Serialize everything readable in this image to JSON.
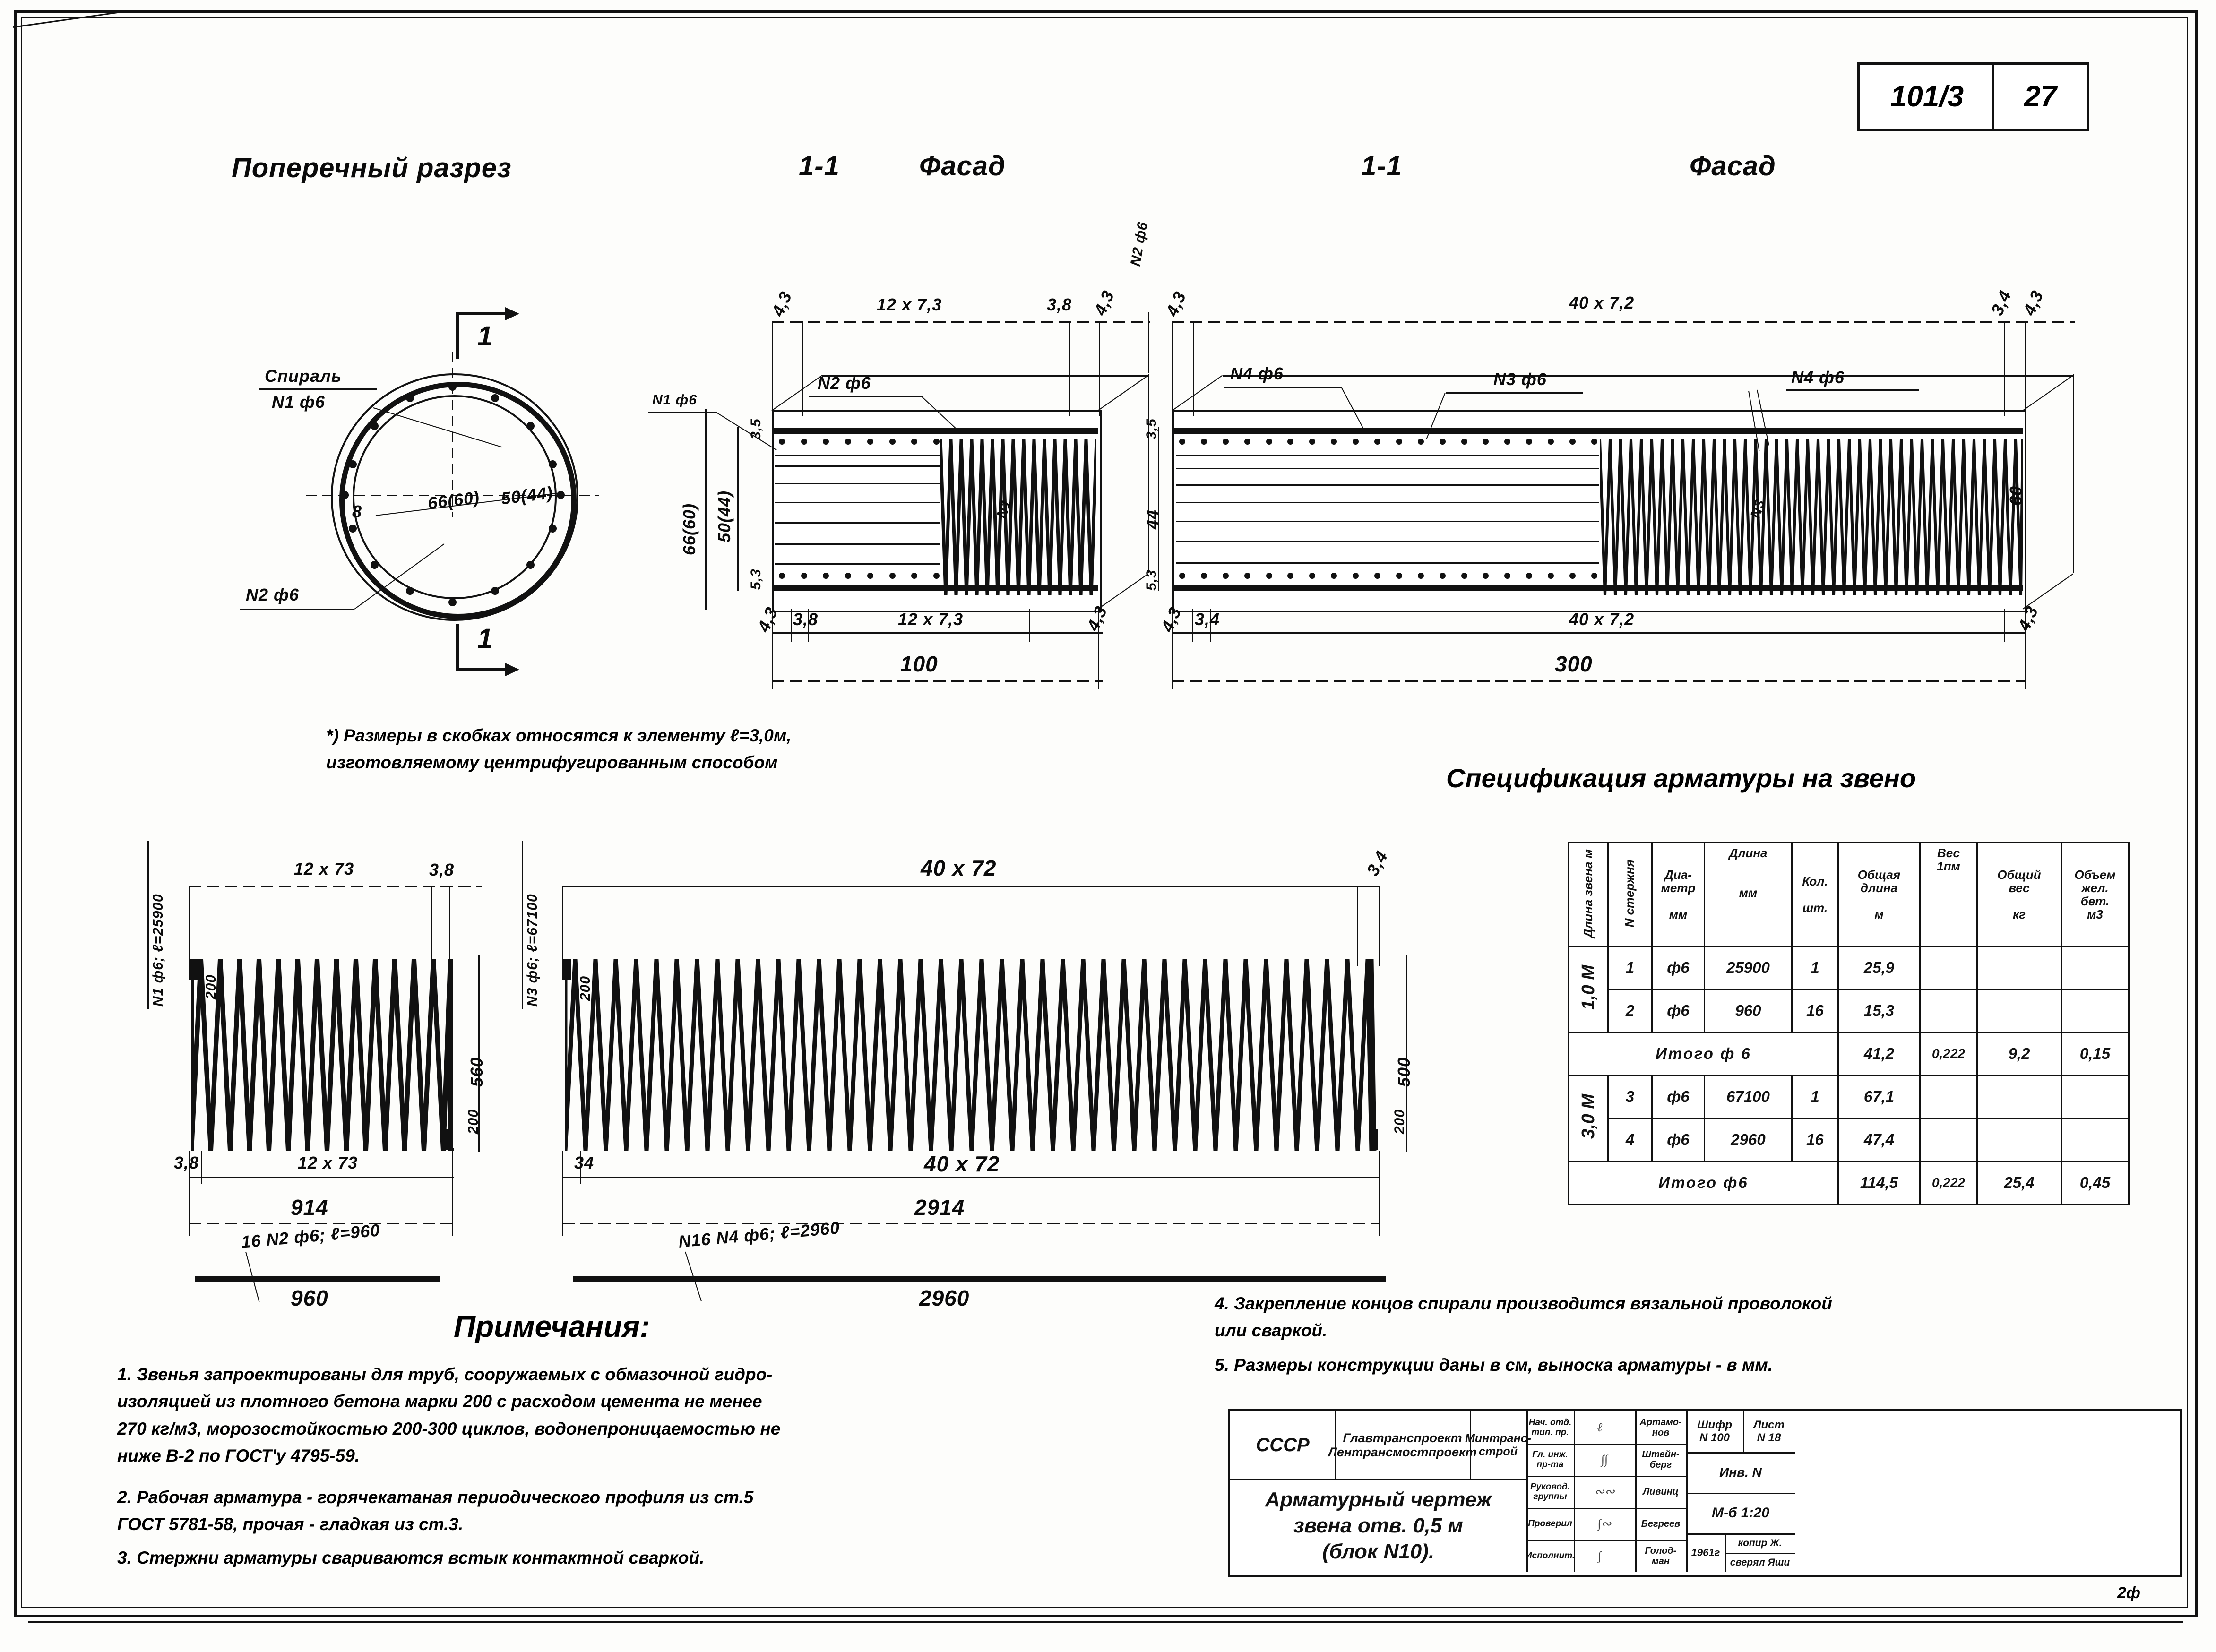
{
  "sheet": {
    "code_left": "101/3",
    "code_right": "27",
    "page_number": "2ф"
  },
  "headings": {
    "cross_section": "Поперечный разрез",
    "section_mark_1": "1-1",
    "facade_1": "Фасад",
    "section_mark_2": "1-1",
    "facade_2": "Фасад"
  },
  "section_view": {
    "spiral_label": "Спираль",
    "spiral_bar": "N1 ф6",
    "bar_n2": "N2 ф6",
    "diameter_outer": "66(60)",
    "diameter_inner": "50(44)",
    "cover": "8",
    "cut_mark": "1"
  },
  "elevation_1m": {
    "top_dims": [
      "4,3",
      "12 x 7,3",
      "3,8",
      "4,3"
    ],
    "top_right_label": "N2 ф6",
    "bottom_dims": [
      "4,3",
      "3,8",
      "12 x 7,3",
      "4,3"
    ],
    "total_length": "100",
    "left_dims": [
      "3,5",
      "5,3"
    ],
    "height_outer": "66(60)",
    "height_inner": "50(44)",
    "bar_n2": "N2 ф6",
    "bar_n1": "N1 ф6",
    "bar_inner": "N1"
  },
  "elevation_3m": {
    "top_dims": [
      "4,3",
      "40 x 7,2",
      "3,4",
      "4,3"
    ],
    "bottom_dims": [
      "4,3",
      "3,4",
      "40 x 7,2",
      "4,3"
    ],
    "total_length": "300",
    "left_dims": [
      "3,5",
      "44",
      "5,3"
    ],
    "right_dim": "60",
    "bar_labels": [
      "N4 ф6",
      "N3 ф6",
      "N4 ф6"
    ],
    "bar_inner": "N3"
  },
  "footnote": "*) Размеры в скобках относятся к элементу ℓ=3,0м,\nизготовляемому центрифугированным способом",
  "spiral_detail_1": {
    "mark": "N1 ф6; ℓ=25900",
    "top_dims": [
      "12 x 73",
      "3,8"
    ],
    "bottom_dims": [
      "3,8",
      "12 x 73"
    ],
    "total": "914",
    "height": "560",
    "end_left": "200",
    "end_right": "200"
  },
  "spiral_detail_2": {
    "mark": "N3 ф6; ℓ=67100",
    "top_dims": [
      "40 x 72",
      "3,4"
    ],
    "bottom_dims": [
      "34",
      "40 x 72"
    ],
    "total": "2914",
    "height": "500",
    "end_left": "200",
    "end_right": "200"
  },
  "bar_detail_1": {
    "label": "16 N2 ф6; ℓ=960",
    "length": "960"
  },
  "bar_detail_2": {
    "label": "N16 N4 ф6; ℓ=2960",
    "length": "2960"
  },
  "spec_table": {
    "title": "Спецификация арматуры на звено",
    "headers": [
      "Длина\nзвена м",
      "N\nстержня",
      "Диа-\nметр\n\nмм",
      "Длина\n\n\nмм",
      "Кол.\n\nшт.",
      "Общая\nдлина\n\nм",
      "Вес\n1пм\n\n",
      "Общий\nвес\n\nкг",
      "Объем\nжел.\nбет.\nм3"
    ],
    "groups": [
      {
        "span_label": "1,0 М",
        "rows": [
          {
            "no": "1",
            "diameter": "ф6",
            "length": "25900",
            "count": "1",
            "total_length": "25,9",
            "weight_per_m": "",
            "total_weight": "",
            "volume": ""
          },
          {
            "no": "2",
            "diameter": "ф6",
            "length": "960",
            "count": "16",
            "total_length": "15,3",
            "weight_per_m": "",
            "total_weight": "",
            "volume": ""
          }
        ],
        "total": {
          "label": "Итого   ф 6",
          "total_length": "41,2",
          "weight_per_m": "0,222",
          "total_weight": "9,2",
          "volume": "0,15"
        }
      },
      {
        "span_label": "3,0 М",
        "rows": [
          {
            "no": "3",
            "diameter": "ф6",
            "length": "67100",
            "count": "1",
            "total_length": "67,1",
            "weight_per_m": "",
            "total_weight": "",
            "volume": ""
          },
          {
            "no": "4",
            "diameter": "ф6",
            "length": "2960",
            "count": "16",
            "total_length": "47,4",
            "weight_per_m": "",
            "total_weight": "",
            "volume": ""
          }
        ],
        "total": {
          "label": "Итого  ф6",
          "total_length": "114,5",
          "weight_per_m": "0,222",
          "total_weight": "25,4",
          "volume": "0,45"
        }
      }
    ]
  },
  "notes": {
    "title": "Примечания:",
    "items_left": [
      "1. Звенья запроектированы для труб, сооружаемых с обмазочной гидро-\n    изоляцией из плотного бетона марки 200 с расходом цемента не менее\n    270 кг/м3, морозостойкостью 200-300 циклов, водонепроницаемостью не\n    ниже В-2 по ГОСТ'у 4795-59.",
      "2. Рабочая арматура - горячекатаная периодического профиля из ст.5\n    ГОСТ 5781-58,  прочая - гладкая  из ст.3.",
      "3. Стержни арматуры свариваются встык контактной сваркой."
    ],
    "items_right": [
      "4. Закрепление концов спирали производится вязальной проволокой\n    или сваркой.",
      "5. Размеры конструкции даны в см, выноска арматуры - в мм."
    ]
  },
  "title_block": {
    "country": "СССР",
    "org_line1": "Главтранспроект",
    "org_line2": "Лентрансмостпроект",
    "ministry_line1": "Минтранс-",
    "ministry_line2": "строй",
    "drawing_title_line1": "Арматурный чертеж",
    "drawing_title_line2": "звена отв. 0,5 м",
    "drawing_title_line3": "(блок N10).",
    "roles": [
      {
        "role": "Нач. отд.\nтип. пр.",
        "name": "Артамо-\nнов"
      },
      {
        "role": "Гл. инж.\nпр-та",
        "name": "Штейн-\nберг"
      },
      {
        "role": "Руковод.\nгруппы",
        "name": "Ливинц"
      },
      {
        "role": "Проверил",
        "name": "Бегреев"
      },
      {
        "role": "Исполнит.",
        "name": "Голод-\nман"
      }
    ],
    "cipher_label": "Шифр",
    "cipher_value": "N 100",
    "sheet_label": "Лист",
    "sheet_value": "N 18",
    "inv_label": "Инв. N",
    "scale": "М-б 1:20",
    "year": "1961г",
    "copy_line1": "копир Ж.",
    "copy_line2": "сверял Яши"
  }
}
